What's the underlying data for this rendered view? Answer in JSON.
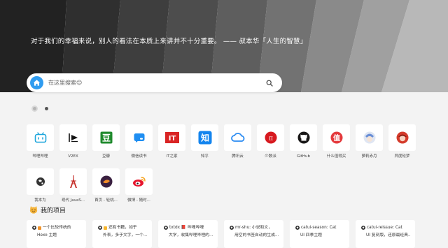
{
  "hero": {
    "quote": "对于我们的幸福来说，别人的看法在本质上来讲并不十分重要。 —— 叔本华「人生的智慧」"
  },
  "search": {
    "engine_icon": "home-icon",
    "placeholder": "在这里搜索😊",
    "value": "",
    "button_icon": "search-icon"
  },
  "pager": {
    "pages": 2,
    "active": 1
  },
  "sites": [
    {
      "label": "哔哩哔哩",
      "icon": "bilibili-icon",
      "color": "#1ea6dc"
    },
    {
      "label": "V2EX",
      "icon": "v2ex-icon",
      "color": "#111111"
    },
    {
      "label": "豆瓣",
      "icon": "douban-icon",
      "color": "#1f8a2d"
    },
    {
      "label": "微信读书",
      "icon": "weread-icon",
      "color": "#1e8ef2"
    },
    {
      "label": "IT之家",
      "icon": "ithome-icon",
      "color": "#d92424"
    },
    {
      "label": "知乎",
      "icon": "zhihu-icon",
      "color": "#1384ee"
    },
    {
      "label": "腾讯云",
      "icon": "tencent-cloud-icon",
      "color": "#2a8bf2"
    },
    {
      "label": "少数派",
      "icon": "sspai-icon",
      "color": "#d7191f"
    },
    {
      "label": "GitHub",
      "icon": "github-icon",
      "color": "#181717"
    },
    {
      "label": "什么值得买",
      "icon": "smzdm-icon",
      "color": "#e4393c"
    },
    {
      "label": "萝莉赤月",
      "icon": "anime-avatar-icon",
      "color": "#6a8fd6"
    },
    {
      "label": "异度轮梦",
      "icon": "anime-red-icon",
      "color": "#d43a2a"
    },
    {
      "label": "我本为",
      "icon": "globe-icon",
      "color": "#333333"
    },
    {
      "label": "现代 JavaS...",
      "icon": "tower-icon",
      "color": "#c5302b"
    },
    {
      "label": "首页 - 轻桃...",
      "icon": "light-app-icon",
      "color": "#3a2040"
    },
    {
      "label": "微博 - 随时...",
      "icon": "weibo-icon",
      "color": "#e6162d"
    }
  ],
  "projects": {
    "icon": "smile-cat-icon",
    "title": "我的项目",
    "items": [
      {
        "line1": "一个比较传统的",
        "line2": "Hexo 主题",
        "badge_color": "#f0932b"
      },
      {
        "line1": "还有书籍，如于",
        "line2": "外表，多于文字，一个...",
        "badge_color": "#f7b731"
      },
      {
        "line1": "txtdx 📕 哔哩哔哩",
        "line2": "大学，收集哔哩哔哩的...",
        "badge_color": ""
      },
      {
        "line1": "mr-shu: 小说和文，",
        "line2": "用空的书签自动的生成...",
        "badge_color": ""
      },
      {
        "line1": "catui-season: Cat",
        "line2": "UI 四季主题",
        "badge_color": ""
      },
      {
        "line1": "catui-reissue: Cat",
        "line2": "UI 复刻版，还原最经典...",
        "badge_color": ""
      }
    ]
  }
}
